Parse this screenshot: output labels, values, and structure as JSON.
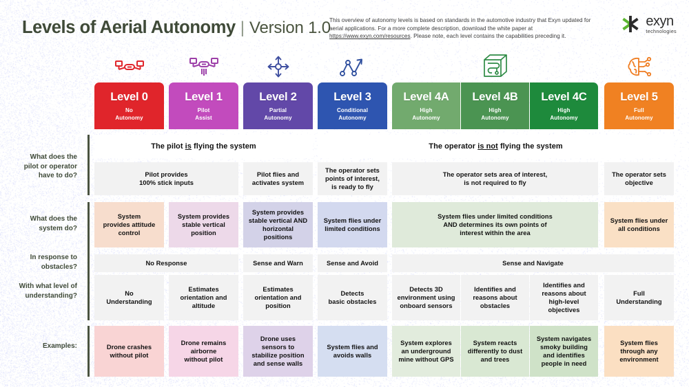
{
  "header": {
    "title_main": "Levels of Aerial Autonomy",
    "title_separator": "|",
    "title_version": "Version 1.0",
    "blurb_part1": "This overview of autonomy levels is based on standards in the automotive industry that Exyn updated for aerial applications. For a more complete description, download the white paper at ",
    "blurb_link": "https://www.exyn.com/resources",
    "blurb_part2": ". Please note, each level contains the capabilities preceding it.",
    "logo_name": "exyn",
    "logo_sub": "technologies"
  },
  "icons": [
    {
      "name": "drone-outline-icon",
      "color": "#e0252b"
    },
    {
      "name": "drone-hover-icon",
      "color": "#9c3fa8"
    },
    {
      "name": "four-way-arrows-icon",
      "color": "#3f4fa0"
    },
    {
      "name": "waypoint-path-icon",
      "color": "#2f4f9e"
    },
    {
      "name": "3d-volume-cube-icon",
      "color": "#2e8b45"
    },
    {
      "name": "ai-brain-circuit-icon",
      "color": "#ef7d22"
    }
  ],
  "levels": [
    {
      "name": "Level 0",
      "sub_line1": "No",
      "sub_line2": "Autonomy",
      "color": "#e0252b",
      "tint_system": "#f7ddcd",
      "tint_example": "#f9d4d4"
    },
    {
      "name": "Level 1",
      "sub_line1": "Pilot",
      "sub_line2": "Assist",
      "color": "#c24bbd",
      "tint_system": "#edd9e9",
      "tint_example": "#f6d6e7"
    },
    {
      "name": "Level 2",
      "sub_line1": "Partial",
      "sub_line2": "Autonomy",
      "color": "#6248a8",
      "tint_system": "#d3d2e8",
      "tint_example": "#ded2e9"
    },
    {
      "name": "Level 3",
      "sub_line1": "Conditional",
      "sub_line2": "Autonomy",
      "color": "#2e55b0",
      "tint_system": "#d3d9ef",
      "tint_example": "#d5def1"
    },
    {
      "name": "Level 4A",
      "sub_line1": "High",
      "sub_line2": "Autonomy",
      "color": "#72aa6e",
      "tint_system": "#dfeada",
      "tint_example": "#e2ecdd"
    },
    {
      "name": "Level 4B",
      "sub_line1": "High",
      "sub_line2": "Autonomy",
      "color": "#4b9452",
      "tint_system": "#dfeada",
      "tint_example": "#d9e8d3"
    },
    {
      "name": "Level 4C",
      "sub_line1": "High",
      "sub_line2": "Autonomy",
      "color": "#1e8a3c",
      "tint_system": "#dfeada",
      "tint_example": "#cfe2c8"
    },
    {
      "name": "Level 5",
      "sub_line1": "Full",
      "sub_line2": "Autonomy",
      "color": "#f08122",
      "tint_system": "#fae0c5",
      "tint_example": "#fbdfc2"
    }
  ],
  "row_labels": [
    {
      "id": "pilot-operator",
      "line1": "What does the",
      "line2": "pilot or operator",
      "line3": "have to do?"
    },
    {
      "id": "system-do",
      "line1": "What does the",
      "line2": "system do?",
      "line3": ""
    },
    {
      "id": "obstacles",
      "line1": "In response to",
      "line2": "obstacles?",
      "line3": ""
    },
    {
      "id": "understanding",
      "line1": "With what level of",
      "line2": "understanding?",
      "line3": ""
    },
    {
      "id": "examples",
      "line1": "Examples:",
      "line2": "",
      "line3": ""
    }
  ],
  "row_banner": {
    "left_pre": "The pilot ",
    "left_em": "is",
    "left_post": " flying the system",
    "right_pre": "The operator ",
    "right_em": "is not",
    "right_post": " flying the system"
  },
  "row_pilot_operator": [
    "Pilot provides\n100% stick inputs",
    "Pilot flies and\nactivates system",
    "The operator sets\npoints of interest,\nis ready to fly",
    "The operator sets area of interest,\nis not required to fly",
    "The operator sets\nobjective"
  ],
  "row_system_do": [
    "System\nprovides attitude\ncontrol",
    "System provides\nstable vertical\nposition",
    "System provides\nstable vertical AND\nhorizontal\npositions",
    "System flies under\nlimited conditions",
    "System flies under limited conditions\nAND determines its own points of\ninterest within the area",
    "System flies under\nall conditions"
  ],
  "row_obstacles": [
    "No Response",
    "Sense and Warn",
    "Sense and Avoid",
    "Sense and Navigate"
  ],
  "row_understanding": [
    "No\nUnderstanding",
    "Estimates\norientation and\naltitude",
    "Estimates\norientation and\nposition",
    "Detects\nbasic obstacles",
    "Detects 3D\nenvironment using\nonboard sensors",
    "Identifies and\nreasons about\nobstacles",
    "Identifies and\nreasons about\nhigh-level\nobjectives",
    "Full\nUnderstanding"
  ],
  "row_examples": [
    "Drone crashes\nwithout pilot",
    "Drone remains\nairborne\nwithout pilot",
    "Drone uses\nsensors to\nstabilize position\nand sense walls",
    "System flies and\navoids walls",
    "System explores\nan underground\nmine without GPS",
    "System reacts\ndifferently to dust\nand trees",
    "System navigates\nsmoky building\nand identifies\npeople in need",
    "System flies\nthrough any\nenvironment"
  ],
  "colors": {
    "neutral_cell": "#f2f2f2",
    "banner_cell": "#ffffff",
    "divider": "#4a5340",
    "title": "#3f4a38"
  }
}
